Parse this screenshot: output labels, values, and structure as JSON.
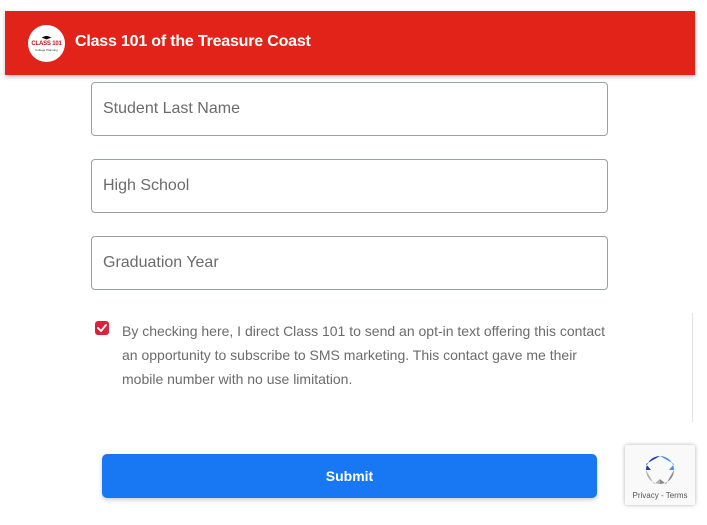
{
  "header": {
    "title": "Class 101 of the Treasure Coast",
    "logo_text": "CLASS 101",
    "logo_subtext": "College Planning",
    "color": "#e2231a"
  },
  "form": {
    "last_name": {
      "placeholder": "Student Last Name",
      "value": ""
    },
    "high_school": {
      "placeholder": "High School",
      "value": ""
    },
    "graduation_year": {
      "placeholder": "Graduation Year",
      "value": ""
    },
    "consent": {
      "checked": true,
      "text": "By checking here, I direct Class 101 to send an opt-in text offering this contact an opportunity to subscribe to SMS marketing. This contact gave me their mobile number with no use limitation.",
      "check_color": "#d9233c"
    },
    "submit_label": "Submit",
    "submit_color": "#1877f2"
  },
  "recaptcha": {
    "privacy": "Privacy",
    "separator": " - ",
    "terms": "Terms",
    "icon": "recaptcha-icon"
  }
}
